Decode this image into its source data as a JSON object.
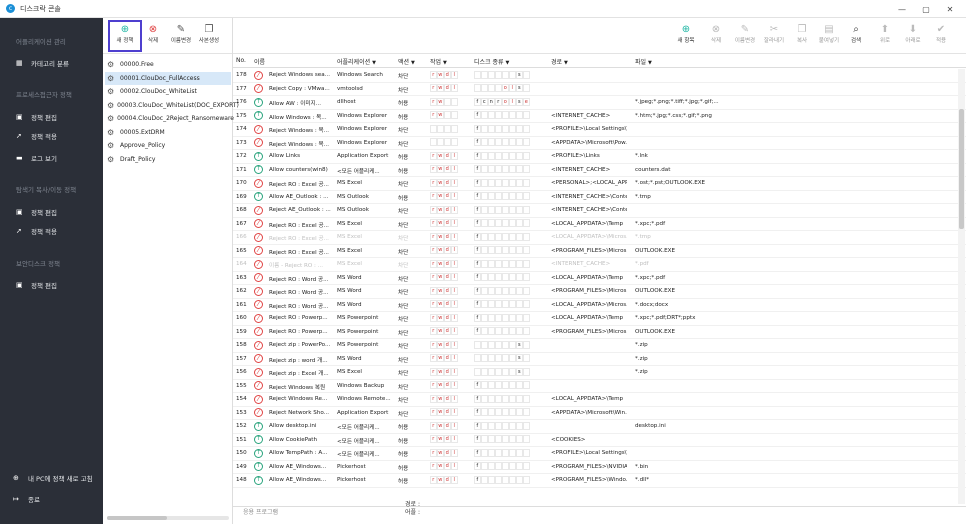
{
  "window": {
    "title": "디스크락 콘솔",
    "min": "—",
    "max": "▢",
    "close": "✕"
  },
  "sidebar": {
    "sections": [
      "어플리케이션 관리",
      "프로세스접근자 정책",
      "탐색기 복사/이동 정책",
      "보안디스크 정책"
    ],
    "items": [
      {
        "label": "카테고리 분류",
        "icon": "grid-icon"
      },
      {
        "label": "정책 편집",
        "icon": "policy-edit-icon"
      },
      {
        "label": "정책 적용",
        "icon": "policy-apply-icon"
      },
      {
        "label": "로그 보기",
        "icon": "log-icon"
      },
      {
        "label": "정책 편집",
        "icon": "policy-edit-icon"
      },
      {
        "label": "정책 적용",
        "icon": "policy-apply-icon"
      },
      {
        "label": "정책 편집",
        "icon": "policy-edit-icon"
      }
    ],
    "bottom": [
      {
        "label": "내 PC에 정책 새로 고침",
        "icon": "refresh-icon"
      },
      {
        "label": "종료",
        "icon": "exit-icon"
      }
    ]
  },
  "tree_toolbar": {
    "new": "새 정책",
    "delete": "삭제",
    "rename": "이름변경",
    "copy": "사본생성"
  },
  "tree": [
    "00000.Free",
    "00001.ClouDoc_FullAccess",
    "00002.ClouDoc_WhiteList",
    "00003.ClouDoc_WhiteList(DOC_EXPORT)",
    "00004.ClouDoc_2Reject_Ransomeware",
    "00005.ExtDRM",
    "Approve_Policy",
    "Draft_Policy"
  ],
  "main_toolbar": [
    "새 항목",
    "삭제",
    "이름변경",
    "잘라내기",
    "복사",
    "붙여넣기",
    "검색",
    "위로",
    "아래로",
    "적용"
  ],
  "columns": {
    "no": "No.",
    "name": "이름",
    "app": "어플리케이션",
    "action": "액션",
    "ops": "작업",
    "disk": "디스크 종류",
    "path": "경로",
    "file": "파일"
  },
  "rows": [
    {
      "no": "178",
      "t": "deny",
      "name": "Reject Windows sea...",
      "app": "Windows Search",
      "act": "차단",
      "ops": "rwdl",
      "disk": "......e",
      "path": "",
      "file": ""
    },
    {
      "no": "177",
      "t": "deny",
      "name": "Reject Copy : VMwa...",
      "app": "vmtoolsd",
      "act": "차단",
      "ops": "rwdl",
      "disk": "....ole",
      "path": "",
      "file": ""
    },
    {
      "no": "176",
      "t": "allow",
      "name": "Allow AW : 이미지...",
      "app": "dllhost",
      "act": "허용",
      "ops": "rw..",
      "disk": "fcnrolse",
      "path": "",
      "file": "*.jpeg;*.png;*.tiff;*.jpg;*.gif;..."
    },
    {
      "no": "175",
      "t": "allow",
      "name": "Allow Windows : 목...",
      "app": "Windows Explorer",
      "act": "허용",
      "ops": "rw..",
      "disk": "f......",
      "path": "<INTERNET_CACHE>",
      "file": "*.htm;*.jpg;*.css;*.gif;*.png"
    },
    {
      "no": "174",
      "t": "deny",
      "name": "Reject Windows : 목...",
      "app": "Windows Explorer",
      "act": "차단",
      "ops": "....",
      "disk": "f......",
      "path": "<PROFILE>\\Local Settings\\T...",
      "file": ""
    },
    {
      "no": "173",
      "t": "deny",
      "name": "Reject Windows : 목...",
      "app": "Windows Explorer",
      "act": "차단",
      "ops": "....",
      "disk": "f......",
      "path": "<APPDATA>\\Microsoft\\Pow...",
      "file": ""
    },
    {
      "no": "172",
      "t": "allow",
      "name": "Allow Links",
      "app": "Application Export",
      "act": "허용",
      "ops": "rwdl",
      "disk": "f......",
      "path": "<PROFILE>\\Links",
      "file": "*.lnk"
    },
    {
      "no": "171",
      "t": "allow",
      "name": "Allow counters(win8)",
      "app": "<모든 어플리케...",
      "act": "허용",
      "ops": "rwdl",
      "disk": "f......",
      "path": "<INTERNET_CACHE>",
      "file": "counters.dat"
    },
    {
      "no": "170",
      "t": "deny",
      "name": "Reject RO : Excel 공...",
      "app": "MS Excel",
      "act": "차단",
      "ops": "rwdl",
      "disk": "f......",
      "path": "<PERSONAL>;<LOCAL_APP...",
      "file": "*.ost;*.pst;OUTLOOK.EXE"
    },
    {
      "no": "169",
      "t": "allow",
      "name": "Allow AE_Outlook : ...",
      "app": "MS Outlook",
      "act": "허용",
      "ops": "rwdl",
      "disk": "f......",
      "path": "<INTERNET_CACHE>\\Conte...",
      "file": "*.tmp"
    },
    {
      "no": "168",
      "t": "deny",
      "name": "Reject AE_Outlook : ...",
      "app": "MS Outlook",
      "act": "차단",
      "ops": "rwdl",
      "disk": "f......",
      "path": "<INTERNET_CACHE>\\Conte...",
      "file": ""
    },
    {
      "no": "167",
      "t": "deny",
      "name": "Reject RO : Excel 공...",
      "app": "MS Excel",
      "act": "차단",
      "ops": "rwdl",
      "disk": "f......",
      "path": "<LOCAL_APPDATA>\\Temp",
      "file": "*.xpc;*.pdf"
    },
    {
      "no": "166",
      "t": "deny",
      "name": "Reject RO : Excel 공...",
      "app": "MS Excel",
      "act": "차단",
      "ops": "rwdl",
      "disk": "f......",
      "path": "<LOCAL_APPDATA>\\Micros...",
      "file": "*.tmp",
      "disabled": true
    },
    {
      "no": "165",
      "t": "deny",
      "name": "Reject RO : Excel 공...",
      "app": "MS Excel",
      "act": "차단",
      "ops": "rwdl",
      "disk": "f......",
      "path": "<PROGRAM_FILES>\\Micros...",
      "file": "OUTLOOK.EXE"
    },
    {
      "no": "164",
      "t": "deny",
      "name": "이름 - Reject RO : ...",
      "app": "MS Excel",
      "act": "차단",
      "ops": "rwdl",
      "disk": "f......",
      "path": "<INTERNET_CACHE>",
      "file": "*.pdf",
      "disabled": true
    },
    {
      "no": "163",
      "t": "deny",
      "name": "Reject RO : Word 공...",
      "app": "MS Word",
      "act": "차단",
      "ops": "rwdl",
      "disk": "f......",
      "path": "<LOCAL_APPDATA>\\Temp",
      "file": "*.xpc;*.pdf"
    },
    {
      "no": "162",
      "t": "deny",
      "name": "Reject RO : Word 공...",
      "app": "MS Word",
      "act": "차단",
      "ops": "rwdl",
      "disk": "f......",
      "path": "<PROGRAM_FILES>\\Micros...",
      "file": "OUTLOOK.EXE"
    },
    {
      "no": "161",
      "t": "deny",
      "name": "Reject RO : Word 공...",
      "app": "MS Word",
      "act": "차단",
      "ops": "rwdl",
      "disk": "f......",
      "path": "<LOCAL_APPDATA>\\Micros...",
      "file": "*.docx;docx"
    },
    {
      "no": "160",
      "t": "deny",
      "name": "Reject RO : Powerp...",
      "app": "MS Powerpoint",
      "act": "차단",
      "ops": "rwdl",
      "disk": "f......",
      "path": "<LOCAL_APPDATA>\\Temp",
      "file": "*.xpc;*.pdf;DRT*;pptx"
    },
    {
      "no": "159",
      "t": "deny",
      "name": "Reject RO : Powerp...",
      "app": "MS Powerpoint",
      "act": "차단",
      "ops": "rwdl",
      "disk": "f......",
      "path": "<PROGRAM_FILES>\\Micros...",
      "file": "OUTLOOK.EXE"
    },
    {
      "no": "158",
      "t": "deny",
      "name": "Reject zip : PowerPo...",
      "app": "MS Powerpoint",
      "act": "차단",
      "ops": "rwdl",
      "disk": "......e",
      "path": "",
      "file": "*.zip"
    },
    {
      "no": "157",
      "t": "deny",
      "name": "Reject zip : word 개...",
      "app": "MS Word",
      "act": "차단",
      "ops": "rwdl",
      "disk": "......e",
      "path": "",
      "file": "*.zip"
    },
    {
      "no": "156",
      "t": "deny",
      "name": "Reject zip : Excel 개...",
      "app": "MS Excel",
      "act": "차단",
      "ops": "rwdl",
      "disk": "......e",
      "path": "",
      "file": "*.zip"
    },
    {
      "no": "155",
      "t": "deny",
      "name": "Reject Windows 복원",
      "app": "Windows Backup",
      "act": "차단",
      "ops": "rwdl",
      "disk": "f......",
      "path": "",
      "file": ""
    },
    {
      "no": "154",
      "t": "deny",
      "name": "Reject Windows Re...",
      "app": "Windows Remote...",
      "act": "차단",
      "ops": "rwdl",
      "disk": "f......",
      "path": "<LOCAL_APPDATA>\\Temp",
      "file": ""
    },
    {
      "no": "153",
      "t": "deny",
      "name": "Reject Network Sho...",
      "app": "Application Export",
      "act": "차단",
      "ops": "rwdl",
      "disk": "f......",
      "path": "<APPDATA>\\Microsoft\\Win...",
      "file": ""
    },
    {
      "no": "152",
      "t": "allow",
      "name": "Allow desktop.ini",
      "app": "<모든 어플리케...",
      "act": "허용",
      "ops": "rwdl",
      "disk": "f......",
      "path": "",
      "file": "desktop.ini"
    },
    {
      "no": "151",
      "t": "allow",
      "name": "Allow CookiePath",
      "app": "<모든 어플리케...",
      "act": "허용",
      "ops": "rwdl",
      "disk": "f......",
      "path": "<COOKIES>",
      "file": ""
    },
    {
      "no": "150",
      "t": "allow",
      "name": "Allow TempPath : A...",
      "app": "<모든 어플리케...",
      "act": "허용",
      "ops": "rwdl",
      "disk": "f......",
      "path": "<PROFILE>\\Local Settings\\T...",
      "file": ""
    },
    {
      "no": "149",
      "t": "allow",
      "name": "Allow AE_Windows...",
      "app": "Pickerhost",
      "act": "허용",
      "ops": "rwdl",
      "disk": "f......",
      "path": "<PROGRAM_FILES>\\NVIDIA...",
      "file": "*.bin"
    },
    {
      "no": "148",
      "t": "allow",
      "name": "Allow AE_Windows...",
      "app": "Pickerhost",
      "act": "허용",
      "ops": "rwdl",
      "disk": "f......",
      "path": "<PROGRAM_FILES>\\Windo...",
      "file": "*.dll*"
    }
  ],
  "footer": {
    "process_label": "응용 프로그램",
    "path_label": "경로 :",
    "app_label": "어플 :"
  }
}
